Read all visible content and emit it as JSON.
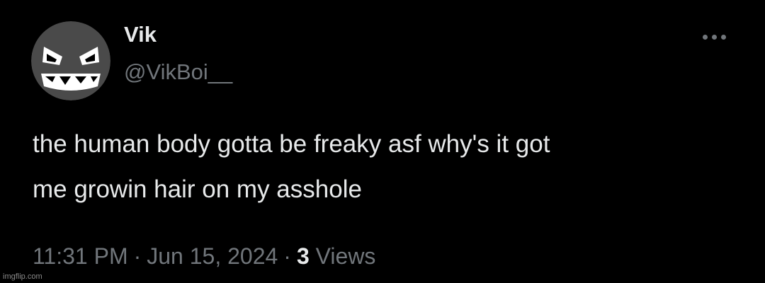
{
  "tweet": {
    "author": {
      "display_name": "Vik",
      "handle": "@VikBoi__",
      "avatar_icon": "angry-face-icon"
    },
    "more_icon": "more-horizontal-icon",
    "text_lines": [
      "the human body gotta be freaky asf why's it got",
      "me growin hair on my asshole"
    ],
    "time": "11:31 PM",
    "date": "Jun 15, 2024",
    "separator": "·",
    "views_count": "3",
    "views_label": "Views"
  },
  "watermark": "imgflip.com",
  "colors": {
    "background": "#000000",
    "primary_text": "#e7e9ea",
    "secondary_text": "#71767b"
  }
}
